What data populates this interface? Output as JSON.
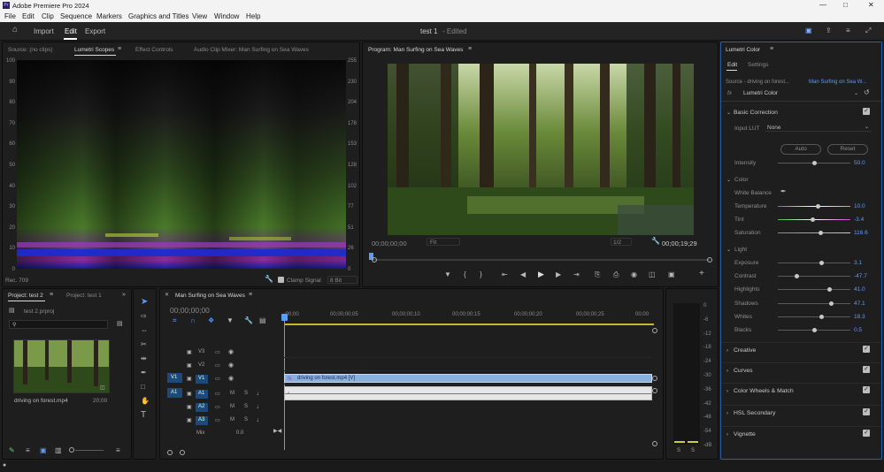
{
  "app": {
    "title": "Adobe Premiere Pro 2024",
    "logo": "Pr"
  },
  "menu": [
    "File",
    "Edit",
    "Clip",
    "Sequence",
    "Markers",
    "Graphics and Titles",
    "View",
    "Window",
    "Help"
  ],
  "header": {
    "tabs": [
      "Import",
      "Edit",
      "Export"
    ],
    "active": "Edit",
    "project_title": "test 1",
    "edited": "- Edited"
  },
  "source_panel": {
    "tabs": [
      "Source: (no clips)",
      "Lumetri Scopes",
      "Effect Controls",
      "Audio Clip Mixer: Man Surfing on Sea Waves"
    ],
    "active": "Lumetri Scopes",
    "left_scale": [
      "100",
      "90",
      "80",
      "70",
      "60",
      "50",
      "40",
      "30",
      "20",
      "10",
      "0"
    ],
    "right_scale": [
      "255",
      "230",
      "204",
      "178",
      "153",
      "128",
      "102",
      "77",
      "51",
      "26",
      "0"
    ],
    "rec": "Rec. 709",
    "clamp": "Clamp Signal",
    "bits": "8 Bit"
  },
  "program": {
    "title": "Program: Man Surfing on Sea Waves",
    "timecode": "00;00;00;00",
    "fit": "Fit",
    "res": "1/2",
    "duration": "00;00;19;29"
  },
  "lumetri": {
    "title": "Lumetri Color",
    "tabs": [
      "Edit",
      "Settings"
    ],
    "source": "Source - driving on forest...",
    "seq": "Man Surfing on Sea W...",
    "fx": "Lumetri Color",
    "basic": "Basic Correction",
    "input_lut": "Input LUT",
    "lut_value": "None",
    "auto": "Auto",
    "reset": "Reset",
    "intensity": {
      "label": "Intensity",
      "value": "50.0",
      "pct": 0.5
    },
    "color_h": "Color",
    "white_balance": "White Balance",
    "sliders_color": [
      {
        "label": "Temperature",
        "value": "10.0",
        "pct": 0.55
      },
      {
        "label": "Tint",
        "value": "-3.4",
        "pct": 0.48
      },
      {
        "label": "Saturation",
        "value": "116.6",
        "pct": 0.58
      }
    ],
    "light_h": "Light",
    "sliders_light": [
      {
        "label": "Exposure",
        "value": "3.1",
        "pct": 0.6
      },
      {
        "label": "Contrast",
        "value": "-47.7",
        "pct": 0.25
      },
      {
        "label": "Highlights",
        "value": "41.0",
        "pct": 0.71
      },
      {
        "label": "Shadows",
        "value": "47.1",
        "pct": 0.73
      },
      {
        "label": "Whites",
        "value": "18.3",
        "pct": 0.6
      },
      {
        "label": "Blacks",
        "value": "0.5",
        "pct": 0.5
      }
    ],
    "sections": [
      "Creative",
      "Curves",
      "Color Wheels & Match",
      "HSL Secondary",
      "Vignette"
    ]
  },
  "project": {
    "tabs": [
      "Project: test 2",
      "Project: test 1"
    ],
    "file": "test 2.prproj",
    "clip_name": "driving on forest.mp4",
    "clip_dur": "20;00"
  },
  "timeline": {
    "title": "Man Surfing on Sea Waves",
    "timecode": "00;00;00;00",
    "ruler": [
      ";00;00",
      "00;00;00;05",
      "00;00;00;10",
      "00;00;00;15",
      "00;00;00;20",
      "00;00;00;25",
      "00;00"
    ],
    "video_tracks": [
      "V3",
      "V2",
      "V1"
    ],
    "audio_tracks": [
      "A1",
      "A2",
      "A3"
    ],
    "mix": "Mix",
    "mix_val": "0.0",
    "clip_label": "driving on forest.mp4 [V]",
    "src_v": "V1",
    "src_a": "A1"
  },
  "meter": {
    "scale": [
      "0",
      "-6",
      "-12",
      "-18",
      "-24",
      "-30",
      "-36",
      "-42",
      "-48",
      "-54",
      "-dB"
    ],
    "solo": [
      "S",
      "S"
    ]
  }
}
